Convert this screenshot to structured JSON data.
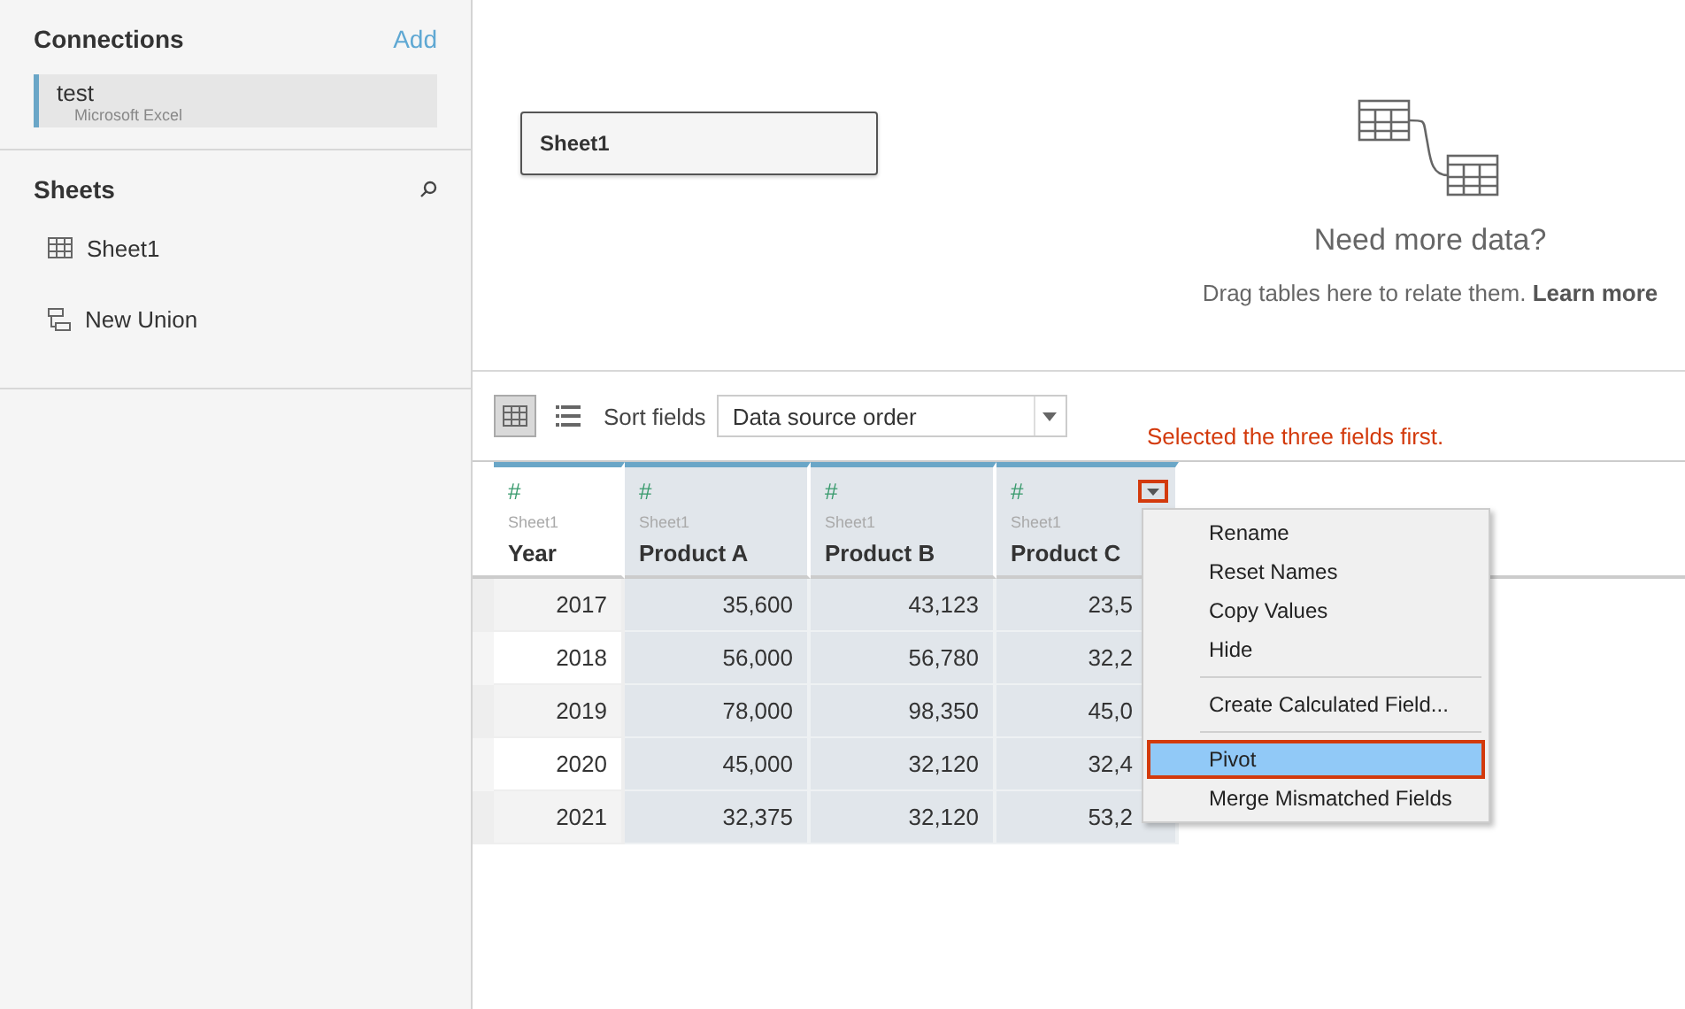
{
  "sidebar": {
    "connections": {
      "title": "Connections",
      "add_link": "Add",
      "items": [
        {
          "name": "test",
          "type": "Microsoft Excel",
          "selected": true
        }
      ]
    },
    "sheets": {
      "title": "Sheets",
      "items": [
        {
          "kind": "table",
          "label": "Sheet1"
        },
        {
          "kind": "union",
          "label": "New Union"
        }
      ]
    }
  },
  "canvas": {
    "tables": [
      "Sheet1"
    ],
    "hint_title": "Need more data?",
    "hint_text": "Drag tables here to relate them.",
    "hint_link": "Learn more"
  },
  "toolbar": {
    "views": [
      {
        "kind": "grid",
        "selected": true
      },
      {
        "kind": "list",
        "selected": false
      }
    ],
    "sort_label": "Sort fields",
    "sort_value": "Data source order"
  },
  "annotation": "Selected the three fields first.",
  "grid": {
    "columns": [
      {
        "type_icon": "#",
        "source": "Sheet1",
        "name": "Year",
        "selected": false
      },
      {
        "type_icon": "#",
        "source": "Sheet1",
        "name": "Product A",
        "selected": true
      },
      {
        "type_icon": "#",
        "source": "Sheet1",
        "name": "Product B",
        "selected": true
      },
      {
        "type_icon": "#",
        "source": "Sheet1",
        "name": "Product C",
        "selected": true,
        "menu_open": true
      }
    ],
    "rows": [
      [
        "2017",
        "35,600",
        "43,123",
        "23,5"
      ],
      [
        "2018",
        "56,000",
        "56,780",
        "32,2"
      ],
      [
        "2019",
        "78,000",
        "98,350",
        "45,0"
      ],
      [
        "2020",
        "45,000",
        "32,120",
        "32,4"
      ],
      [
        "2021",
        "32,375",
        "32,120",
        "53,2"
      ]
    ]
  },
  "context_menu": {
    "groups": [
      [
        {
          "label": "Rename",
          "highlighted": false
        },
        {
          "label": "Reset Names",
          "highlighted": false
        },
        {
          "label": "Copy Values",
          "highlighted": false
        },
        {
          "label": "Hide",
          "highlighted": false
        }
      ],
      [
        {
          "label": "Create Calculated Field...",
          "highlighted": false
        }
      ],
      [
        {
          "label": "Pivot",
          "highlighted": true
        },
        {
          "label": "Merge Mismatched Fields",
          "highlighted": false
        }
      ]
    ]
  }
}
